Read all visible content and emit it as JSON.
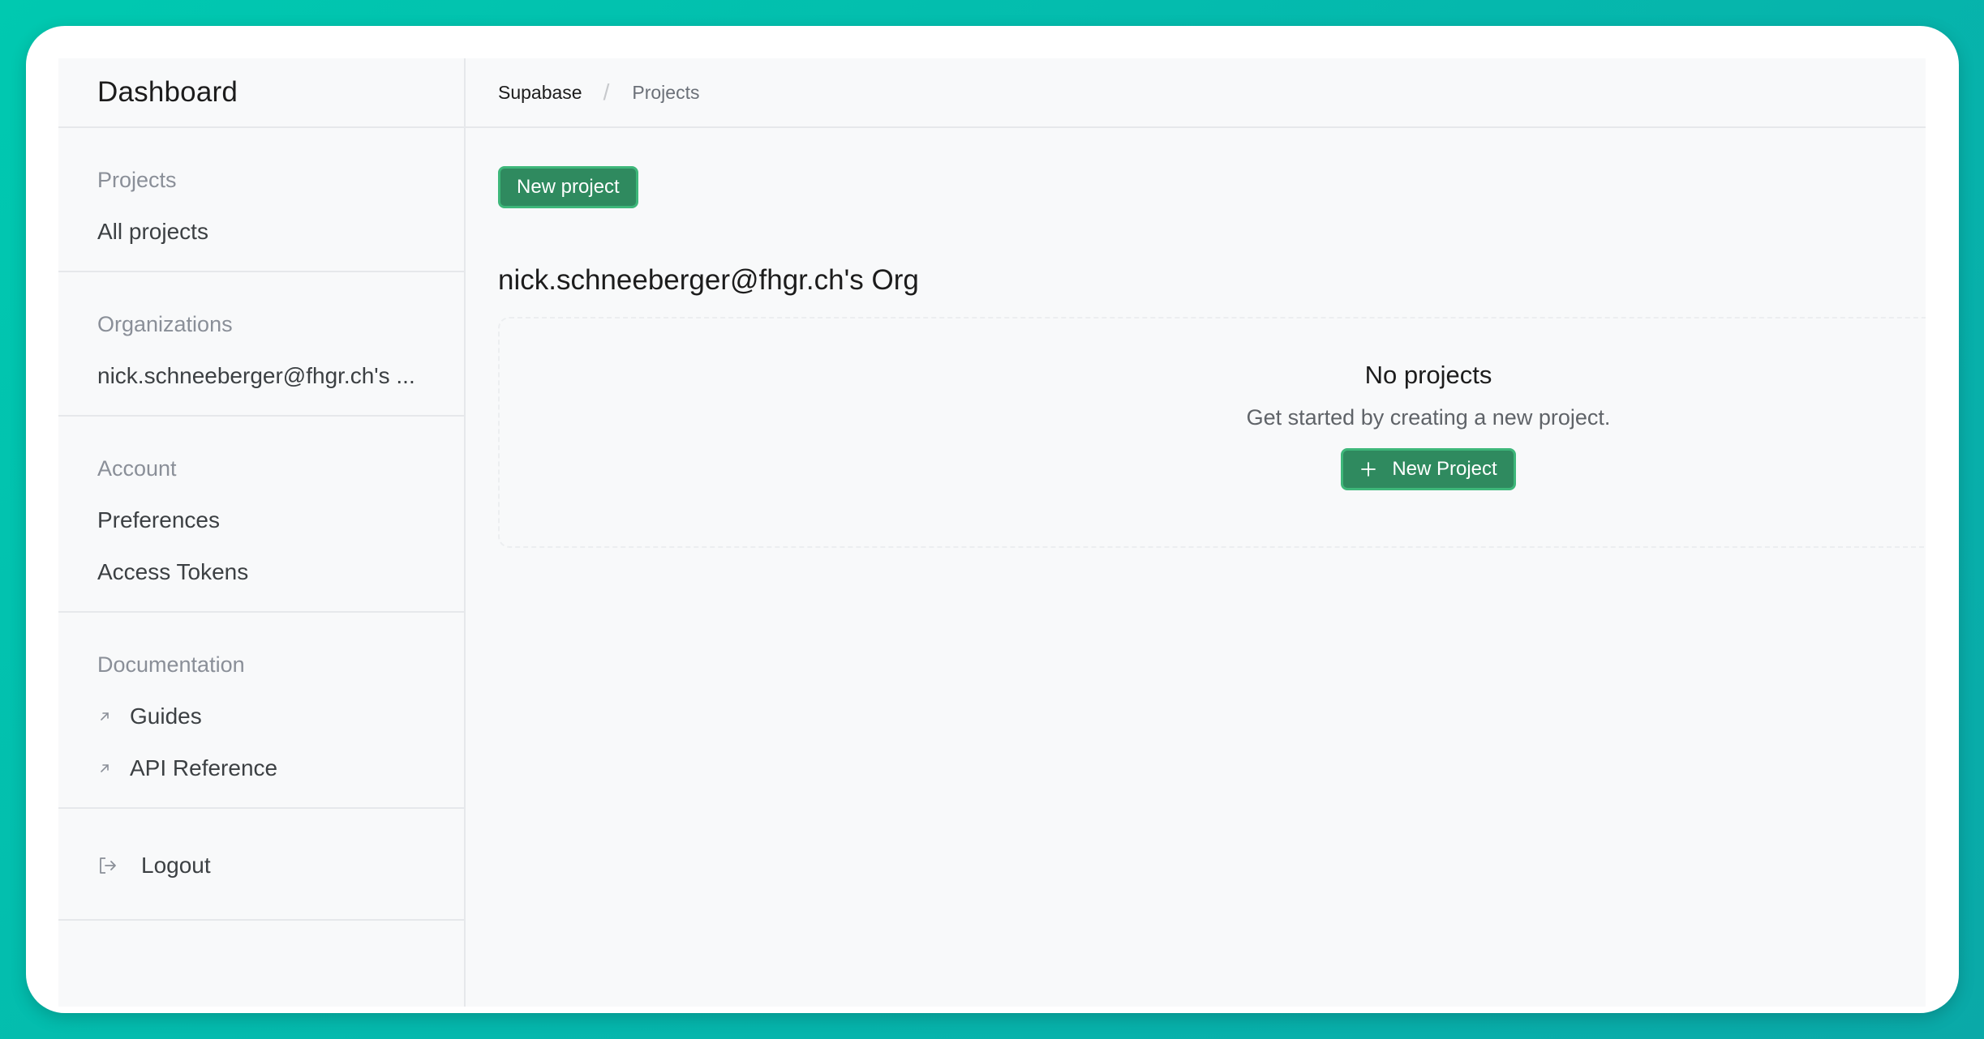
{
  "sidebar": {
    "title": "Dashboard",
    "sections": [
      {
        "heading": "Projects",
        "items": [
          {
            "label": "All projects"
          }
        ]
      },
      {
        "heading": "Organizations",
        "items": [
          {
            "label": "nick.schneeberger@fhgr.ch's ..."
          }
        ]
      },
      {
        "heading": "Account",
        "items": [
          {
            "label": "Preferences"
          },
          {
            "label": "Access Tokens"
          }
        ]
      },
      {
        "heading": "Documentation",
        "items": [
          {
            "label": "Guides",
            "icon": "external-link-icon"
          },
          {
            "label": "API Reference",
            "icon": "external-link-icon"
          }
        ]
      }
    ],
    "logout": {
      "label": "Logout",
      "icon": "logout-icon"
    }
  },
  "breadcrumb": {
    "root": "Supabase",
    "separator": "/",
    "current": "Projects"
  },
  "main": {
    "new_project_button": "New project",
    "org_title": "nick.schneeberger@fhgr.ch's Org",
    "empty_state": {
      "title": "No projects",
      "description": "Get started by creating a new project.",
      "button_label": "New Project",
      "button_icon": "plus-icon"
    }
  },
  "colors": {
    "brand_green": "#2f8a5f",
    "brand_green_border": "#3eb77a",
    "background_gradient_start": "#00c9b0",
    "background_gradient_end": "#0aa9a8"
  }
}
